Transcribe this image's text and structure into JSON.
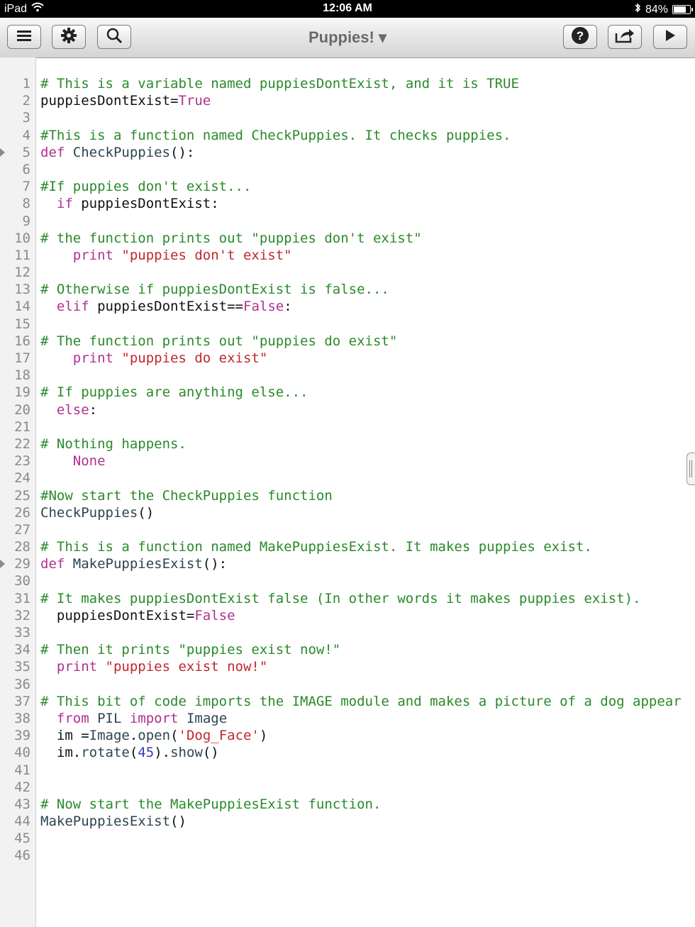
{
  "status_bar": {
    "device": "iPad",
    "time": "12:06 AM",
    "battery": "84%",
    "battery_level": 0.84
  },
  "toolbar": {
    "title": "Puppies!",
    "title_arrow": "▾",
    "icons": [
      "menu-icon",
      "gear-icon",
      "search-icon",
      "help-icon",
      "share-icon",
      "play-icon"
    ]
  },
  "colors": {
    "comment": "#2a8a2a",
    "keyword": "#b0308f",
    "string": "#c0282c",
    "number": "#3040b0",
    "line_number": "#8a8a8a",
    "gutter": "#f2f2f2"
  },
  "editor": {
    "fold_marker_lines": [
      5,
      29
    ],
    "lines": [
      [
        [
          "comment",
          "# This is a variable named puppiesDontExist, and it is TRUE"
        ]
      ],
      [
        [
          "plain",
          "puppiesDontExist="
        ],
        [
          "kw",
          "True"
        ]
      ],
      [],
      [
        [
          "comment",
          "#This is a function named CheckPuppies. It checks puppies."
        ]
      ],
      [
        [
          "kw",
          "def "
        ],
        [
          "fn",
          "CheckPuppies"
        ],
        [
          "plain",
          "():"
        ]
      ],
      [],
      [
        [
          "comment",
          "#If puppies don't exist..."
        ]
      ],
      [
        [
          "plain",
          "  "
        ],
        [
          "kw",
          "if "
        ],
        [
          "plain",
          "puppiesDontExist:"
        ]
      ],
      [],
      [
        [
          "comment",
          "# the function prints out \"puppies don't exist\""
        ]
      ],
      [
        [
          "plain",
          "    "
        ],
        [
          "kw",
          "print "
        ],
        [
          "str",
          "\"puppies don't exist\""
        ]
      ],
      [],
      [
        [
          "comment",
          "# Otherwise if puppiesDontExist is false..."
        ]
      ],
      [
        [
          "plain",
          "  "
        ],
        [
          "kw",
          "elif "
        ],
        [
          "plain",
          "puppiesDontExist=="
        ],
        [
          "kw",
          "False"
        ],
        [
          "plain",
          ":"
        ]
      ],
      [],
      [
        [
          "comment",
          "# The function prints out \"puppies do exist\""
        ]
      ],
      [
        [
          "plain",
          "    "
        ],
        [
          "kw",
          "print "
        ],
        [
          "str",
          "\"puppies do exist\""
        ]
      ],
      [],
      [
        [
          "comment",
          "# If puppies are anything else..."
        ]
      ],
      [
        [
          "plain",
          "  "
        ],
        [
          "kw",
          "else"
        ],
        [
          "plain",
          ":"
        ]
      ],
      [],
      [
        [
          "comment",
          "# Nothing happens."
        ]
      ],
      [
        [
          "plain",
          "    "
        ],
        [
          "kw",
          "None"
        ]
      ],
      [],
      [
        [
          "comment",
          "#Now start the CheckPuppies function"
        ]
      ],
      [
        [
          "fn",
          "CheckPuppies"
        ],
        [
          "plain",
          "()"
        ]
      ],
      [],
      [
        [
          "comment",
          "# This is a function named MakePuppiesExist. It makes puppies exist."
        ]
      ],
      [
        [
          "kw",
          "def "
        ],
        [
          "fn",
          "MakePuppiesExist"
        ],
        [
          "plain",
          "():"
        ]
      ],
      [],
      [
        [
          "comment",
          "# It makes puppiesDontExist false (In other words it makes puppies exist)."
        ]
      ],
      [
        [
          "plain",
          "  puppiesDontExist="
        ],
        [
          "kw",
          "False"
        ]
      ],
      [],
      [
        [
          "comment",
          "# Then it prints \"puppies exist now!\""
        ]
      ],
      [
        [
          "plain",
          "  "
        ],
        [
          "kw",
          "print "
        ],
        [
          "str",
          "\"puppies exist now!\""
        ]
      ],
      [],
      [
        [
          "comment",
          "# This bit of code imports the IMAGE module and makes a picture of a dog appear"
        ]
      ],
      [
        [
          "plain",
          "  "
        ],
        [
          "kw",
          "from "
        ],
        [
          "fn",
          "PIL "
        ],
        [
          "kw",
          "import "
        ],
        [
          "fn",
          "Image"
        ]
      ],
      [
        [
          "plain",
          "  im ="
        ],
        [
          "fn",
          "Image"
        ],
        [
          "plain",
          "."
        ],
        [
          "fn",
          "open"
        ],
        [
          "plain",
          "("
        ],
        [
          "str",
          "'Dog_Face'"
        ],
        [
          "plain",
          ")"
        ]
      ],
      [
        [
          "plain",
          "  im."
        ],
        [
          "fn",
          "rotate"
        ],
        [
          "plain",
          "("
        ],
        [
          "num",
          "45"
        ],
        [
          "plain",
          ")."
        ],
        [
          "fn",
          "show"
        ],
        [
          "plain",
          "()"
        ]
      ],
      [],
      [],
      [
        [
          "comment",
          "# Now start the MakePuppiesExist function."
        ]
      ],
      [
        [
          "fn",
          "MakePuppiesExist"
        ],
        [
          "plain",
          "()"
        ]
      ],
      [],
      []
    ]
  }
}
